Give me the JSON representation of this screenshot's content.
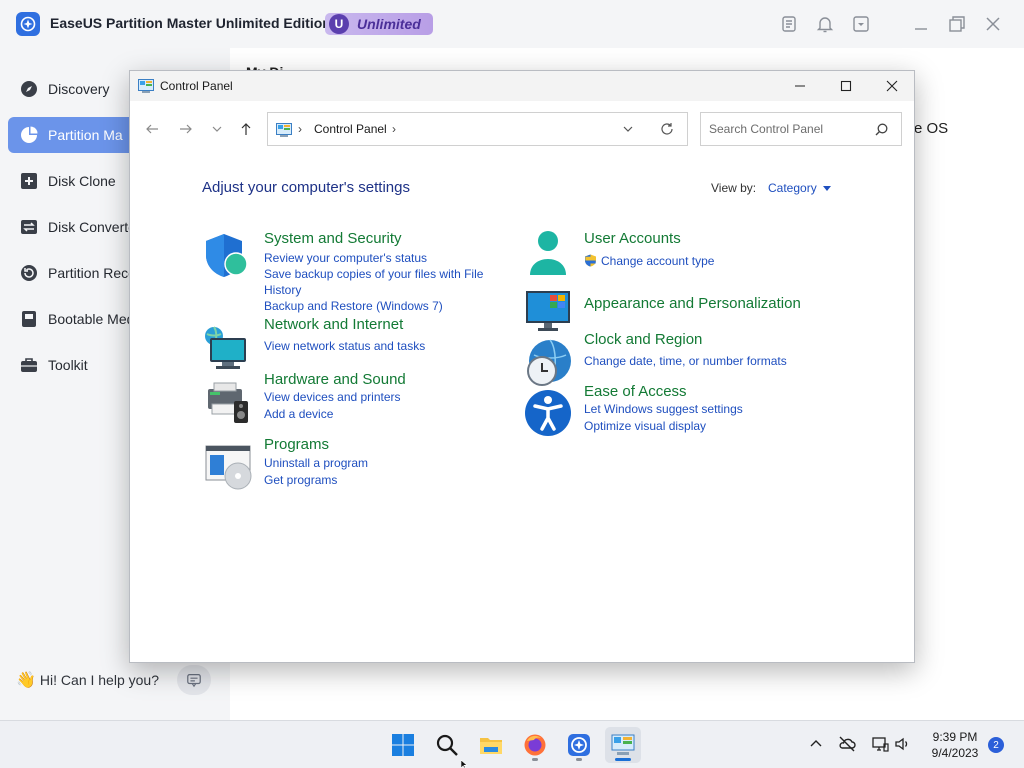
{
  "easeus": {
    "title": "EaseUS Partition Master Unlimited Edition",
    "badge_letter": "U",
    "badge_text": "Unlimited",
    "sidebar": [
      {
        "label": "Discovery",
        "icon": "compass-icon",
        "active": false
      },
      {
        "label": "Partition Ma",
        "icon": "pie-chart-icon",
        "active": true
      },
      {
        "label": "Disk Clone",
        "icon": "plus-square-icon",
        "active": false
      },
      {
        "label": "Disk Converte",
        "icon": "convert-icon",
        "active": false
      },
      {
        "label": "Partition Reco",
        "icon": "recover-icon",
        "active": false
      },
      {
        "label": "Bootable Med",
        "icon": "media-icon",
        "active": false
      },
      {
        "label": "Toolkit",
        "icon": "toolbox-icon",
        "active": false
      }
    ],
    "help_text": "Hi! Can I help you?",
    "main_peek_title": "My Di",
    "main_peek_os": "e OS",
    "accent": "#6b94ea"
  },
  "control_panel": {
    "title": "Control Panel",
    "address_crumb": "Control Panel",
    "search_placeholder": "Search Control Panel",
    "heading": "Adjust your computer's settings",
    "view_by_label": "View by:",
    "view_by_value": "Category",
    "categories_left": [
      {
        "title": "System and Security",
        "icon": "shield-icon",
        "links": [
          "Review your computer's status",
          "Save backup copies of your files with File History",
          "Backup and Restore (Windows 7)"
        ]
      },
      {
        "title": "Network and Internet",
        "icon": "network-globe-icon",
        "links": [
          "View network status and tasks"
        ]
      },
      {
        "title": "Hardware and Sound",
        "icon": "printer-speaker-icon",
        "links": [
          "View devices and printers",
          "Add a device"
        ]
      },
      {
        "title": "Programs",
        "icon": "programs-disc-icon",
        "links": [
          "Uninstall a program",
          "Get programs"
        ]
      }
    ],
    "categories_right": [
      {
        "title": "User Accounts",
        "icon": "user-icon",
        "links": [
          "Change account type"
        ]
      },
      {
        "title": "Appearance and Personalization",
        "icon": "monitor-icon",
        "links": []
      },
      {
        "title": "Clock and Region",
        "icon": "clock-globe-icon",
        "links": [
          "Change date, time, or number formats"
        ]
      },
      {
        "title": "Ease of Access",
        "icon": "accessibility-icon",
        "links": [
          "Let Windows suggest settings",
          "Optimize visual display"
        ]
      }
    ],
    "title_color": "#137a35",
    "link_color": "#1f4fbf"
  },
  "taskbar": {
    "apps": [
      "windows-start-icon",
      "search-icon",
      "file-explorer-icon",
      "firefox-icon",
      "easeus-icon",
      "control-panel-icon"
    ],
    "time": "9:39 PM",
    "date": "9/4/2023",
    "notification_count": "2"
  }
}
